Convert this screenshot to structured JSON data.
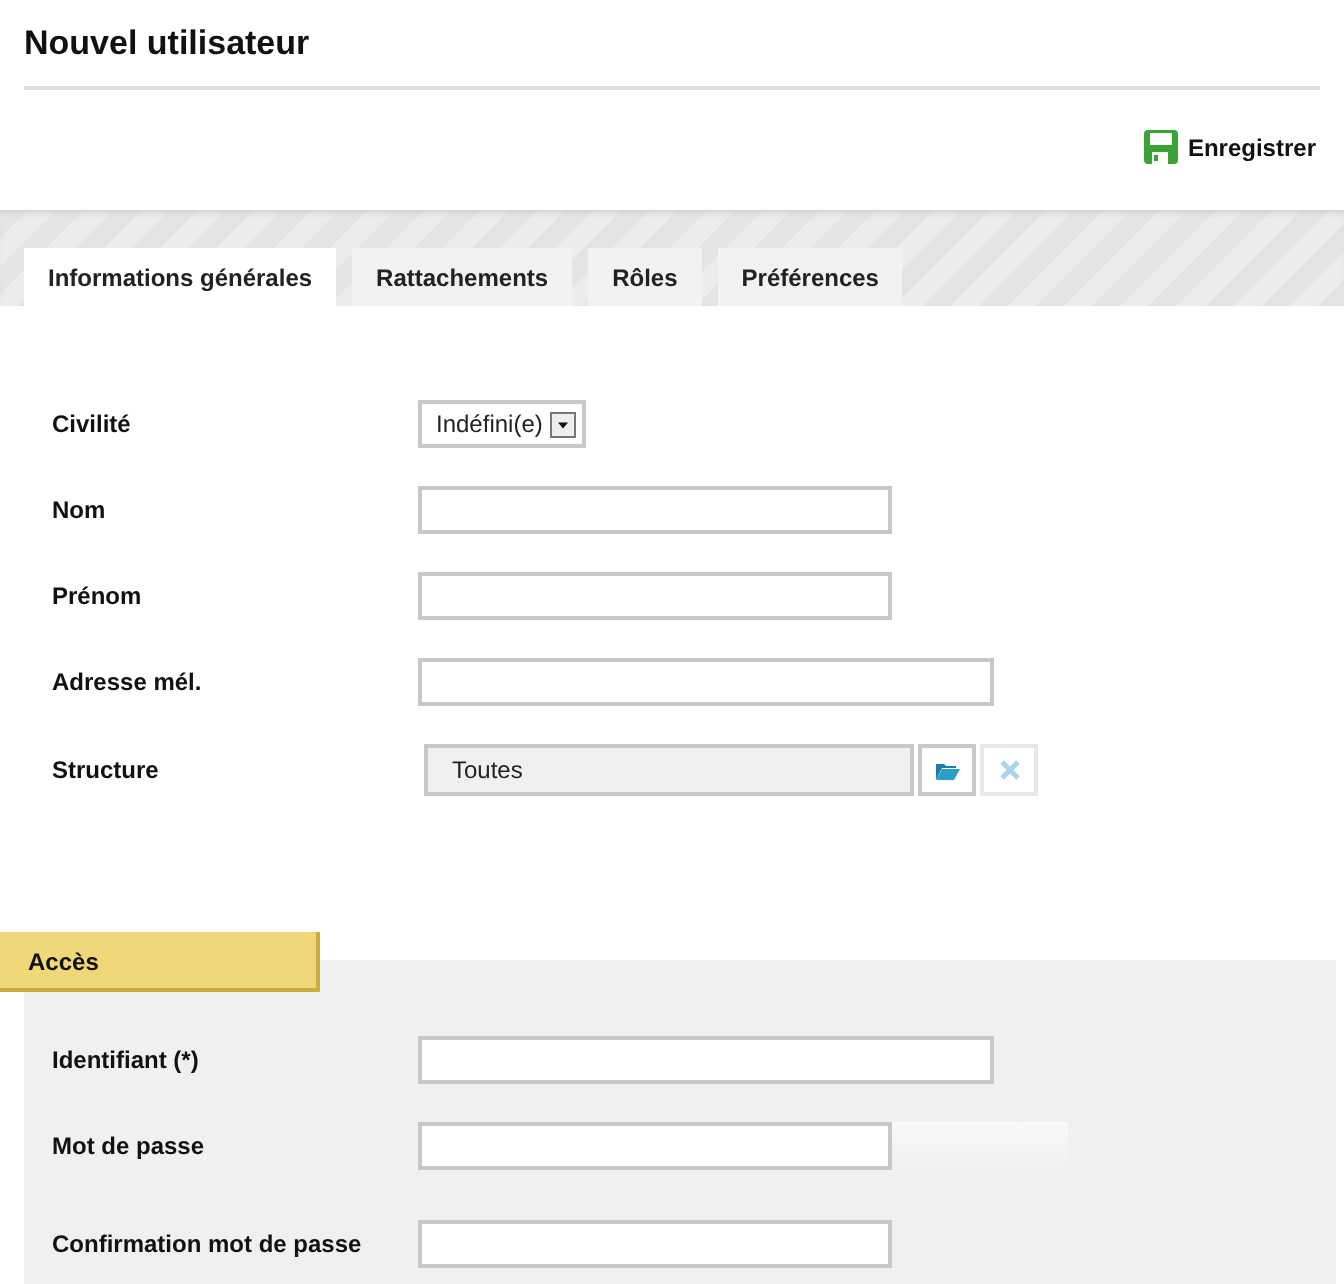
{
  "page": {
    "title": "Nouvel utilisateur"
  },
  "toolbar": {
    "save_label": "Enregistrer"
  },
  "tabs": [
    {
      "label": "Informations générales",
      "selected": true
    },
    {
      "label": "Rattachements",
      "selected": false
    },
    {
      "label": "Rôles",
      "selected": false
    },
    {
      "label": "Préférences",
      "selected": false
    }
  ],
  "general_fields": [
    {
      "label": "Civilité",
      "kind": "select",
      "value": "Indéfini(e)"
    },
    {
      "label": "Nom",
      "kind": "text"
    },
    {
      "label": "Prénom",
      "kind": "text"
    },
    {
      "label": "Adresse mél.",
      "kind": "wide"
    },
    {
      "label": "Structure",
      "kind": "picker",
      "value": "Toutes"
    }
  ],
  "access": {
    "title": "Accès",
    "fields": [
      {
        "label": "Identifiant (*)",
        "kind": "wide"
      },
      {
        "label": "Mot de passe",
        "kind": "password"
      },
      {
        "label": "Confirmation mot de passe",
        "kind": "text"
      }
    ]
  }
}
